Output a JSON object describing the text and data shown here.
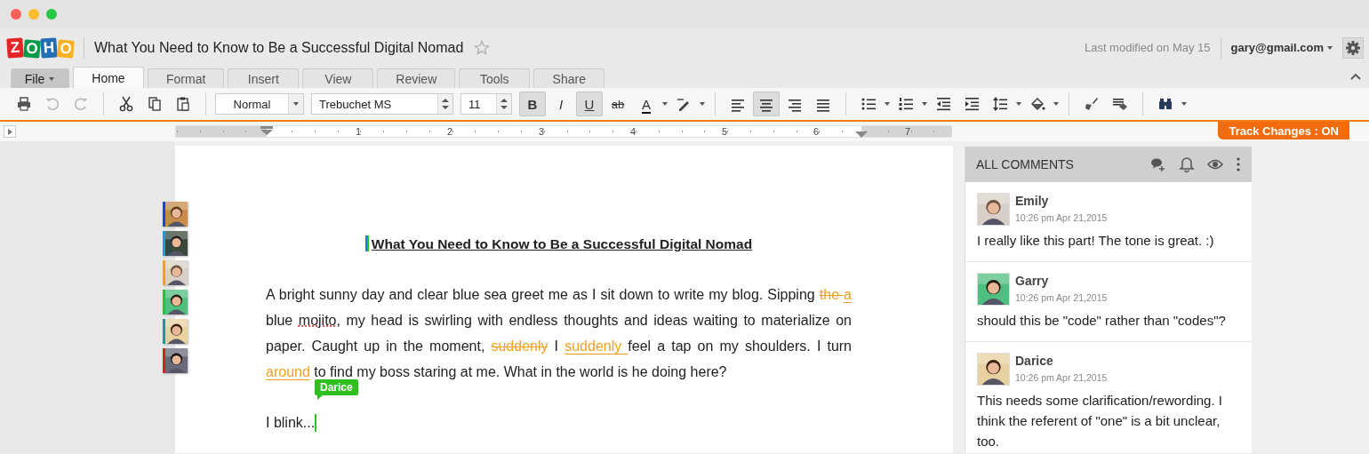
{
  "window": {
    "title": "What You Need to Know to Be a Successful Digital Nomad"
  },
  "logo": [
    {
      "letter": "Z",
      "color": "#e42527"
    },
    {
      "letter": "O",
      "color": "#089949"
    },
    {
      "letter": "H",
      "color": "#226db4"
    },
    {
      "letter": "O",
      "color": "#f9b21d"
    }
  ],
  "header": {
    "starred": false,
    "last_modified": "Last modified on May 15",
    "account": "gary@gmail.com"
  },
  "tabs": [
    {
      "label": "File",
      "kind": "menu",
      "selected": false
    },
    {
      "label": "Home",
      "kind": "tab",
      "selected": true
    },
    {
      "label": "Format",
      "kind": "tab",
      "selected": false
    },
    {
      "label": "Insert",
      "kind": "tab",
      "selected": false
    },
    {
      "label": "View",
      "kind": "tab",
      "selected": false
    },
    {
      "label": "Review",
      "kind": "tab",
      "selected": false
    },
    {
      "label": "Tools",
      "kind": "tab",
      "selected": false
    },
    {
      "label": "Share",
      "kind": "tab",
      "selected": false
    }
  ],
  "toolbar": {
    "undo_disabled": true,
    "redo_disabled": true,
    "style": "Normal",
    "font": "Trebuchet MS",
    "size": "11",
    "format_buttons": [
      {
        "kind": "bold",
        "label": "B",
        "pressed": true
      },
      {
        "kind": "italic",
        "label": "I",
        "pressed": false
      },
      {
        "kind": "underline",
        "label": "U",
        "pressed": true
      },
      {
        "kind": "strike",
        "label": "ab",
        "pressed": false
      },
      {
        "kind": "color",
        "label": "A",
        "pressed": false
      }
    ],
    "alignment": [
      {
        "selected": false
      },
      {
        "selected": true
      },
      {
        "selected": false
      },
      {
        "selected": false
      }
    ]
  },
  "ruler": {
    "labels": [
      "1",
      "2",
      "3",
      "4",
      "5",
      "6",
      "7"
    ]
  },
  "track_changes": "Track Changes : ON",
  "reviewers": [
    {
      "color": "#1a44d8"
    },
    {
      "color": "#1e9be0"
    },
    {
      "color": "#f0a020"
    },
    {
      "color": "#28c040"
    },
    {
      "color": "#1a9a9a"
    },
    {
      "color": "#d42020"
    }
  ],
  "document": {
    "title": "What You Need to Know to Be a Successful Digital Nomad",
    "paragraph": [
      {
        "kind": "text",
        "text": "A bright sunny day and clear blue sea greet me as I sit down to write my blog. Sipping "
      },
      {
        "kind": "deleted",
        "text": "the "
      },
      {
        "kind": "inserted",
        "text": "a "
      },
      {
        "kind": "text",
        "text": "blue "
      },
      {
        "kind": "misspelled",
        "text": "mojito"
      },
      {
        "kind": "text",
        "text": ", my head is swirling with endless thoughts and ideas waiting to materialize on paper. Caught up in the moment, "
      },
      {
        "kind": "deleted",
        "text": "suddenly"
      },
      {
        "kind": "text",
        "text": " I "
      },
      {
        "kind": "inserted",
        "text": "suddenly "
      },
      {
        "kind": "text",
        "text": "feel a tap on my shoulders. I turn "
      },
      {
        "kind": "inserted",
        "text": "around"
      },
      {
        "kind": "text",
        "text": " to find my boss staring at me. What in the world is he doing here?"
      }
    ],
    "last_line": "I blink...",
    "cursor": {
      "user": "Darice",
      "color": "#2fbf1f"
    }
  },
  "comments_panel": {
    "title": "ALL COMMENTS",
    "comments": [
      {
        "author": "Emily",
        "time": "10:26 pm Apr 21,2015",
        "text": "I really like this part! The tone is great. :)"
      },
      {
        "author": "Garry",
        "time": "10:26 pm Apr 21,2015",
        "text": "should this be \"code\" rather than \"codes\"?"
      },
      {
        "author": "Darice",
        "time": "10:26 pm Apr 21,2015",
        "text": "This needs some clarification/rewording. I think the referent of \"one\" is a bit unclear, too."
      }
    ]
  }
}
